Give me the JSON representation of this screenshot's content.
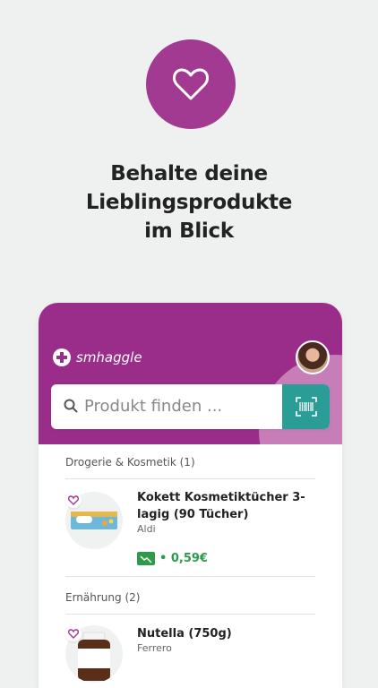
{
  "headline": [
    "Behalte deine",
    "Lieblingsprodukte",
    "im Blick"
  ],
  "app": {
    "logo_text": "smhaggle",
    "search_placeholder": "Produkt finden ..."
  },
  "sections": [
    {
      "title": "Drogerie & Kosmetik (1)",
      "products": [
        {
          "name": "Kokett Kosmetiktücher 3-lagig (90 Tücher)",
          "store": "Aldi",
          "price": "• 0,59€"
        }
      ]
    },
    {
      "title": "Ernährung (2)",
      "products": [
        {
          "name": "Nutella (750g)",
          "store": "Ferrero"
        }
      ]
    }
  ],
  "colors": {
    "brand": "#9a2d89",
    "accent": "#2a9d97",
    "price": "#2e9a4a"
  }
}
